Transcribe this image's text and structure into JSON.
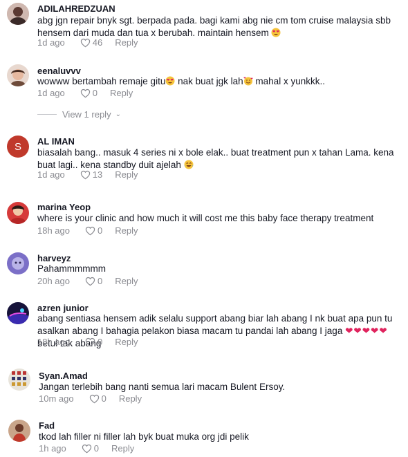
{
  "comments": [
    {
      "username": "ADILAHREDZUAN",
      "text": "abg jgn repair bnyk sgt. berpada pada. bagi kami abg nie cm tom cruise malaysia sbb hensem dari muda dan tua x berubah. maintain hensem",
      "time": "1d ago",
      "likes": "46",
      "reply": "Reply"
    },
    {
      "username": "eenaluvvv",
      "text_a": "wowww bertambah remaje gitu",
      "text_b": " nak buat jgk lah",
      "text_c": " mahal x yunkkk..",
      "time": "1d ago",
      "likes": "0",
      "reply": "Reply"
    },
    {
      "username": "AL IMAN",
      "avatar_letter": "S",
      "text": "biasalah bang.. masuk 4 series ni x bole elak.. buat treatment pun x tahan Lama. kena buat lagi.. kena standby duit ajelah",
      "time": "1d ago",
      "likes": "13",
      "reply": "Reply"
    },
    {
      "username": "marina Yeop",
      "text": "where is your clinic and how much it will cost me this baby face therapy treatment",
      "time": "18h ago",
      "likes": "0",
      "reply": "Reply"
    },
    {
      "username": "harveyz",
      "text": "Pahammmmmm",
      "time": "20h ago",
      "likes": "0",
      "reply": "Reply"
    },
    {
      "username": "azren junior",
      "text_a": "abang sentiasa hensem adik selalu support abang biar lah abang I nk buat apa pun tu asalkan abang I bahagia pelakon biasa macam tu pandai lah abang I jaga ",
      "text_b": "betul tak abang",
      "time": "18h ago",
      "likes": "0",
      "reply": "Reply"
    },
    {
      "username": "Syan.Amad",
      "text": "Jangan terlebih bang nanti semua lari macam Bulent Ersoy.",
      "time": "10m ago",
      "likes": "0",
      "reply": "Reply"
    },
    {
      "username": "Fad",
      "text": "tkod lah filler ni filler lah byk buat muka org jdi pelik",
      "time": "1h ago",
      "likes": "0",
      "reply": "Reply"
    }
  ],
  "view_replies": "View 1 reply",
  "colors": {
    "text": "#161823",
    "meta": "#8a8b91",
    "accent": "#c0392b"
  }
}
